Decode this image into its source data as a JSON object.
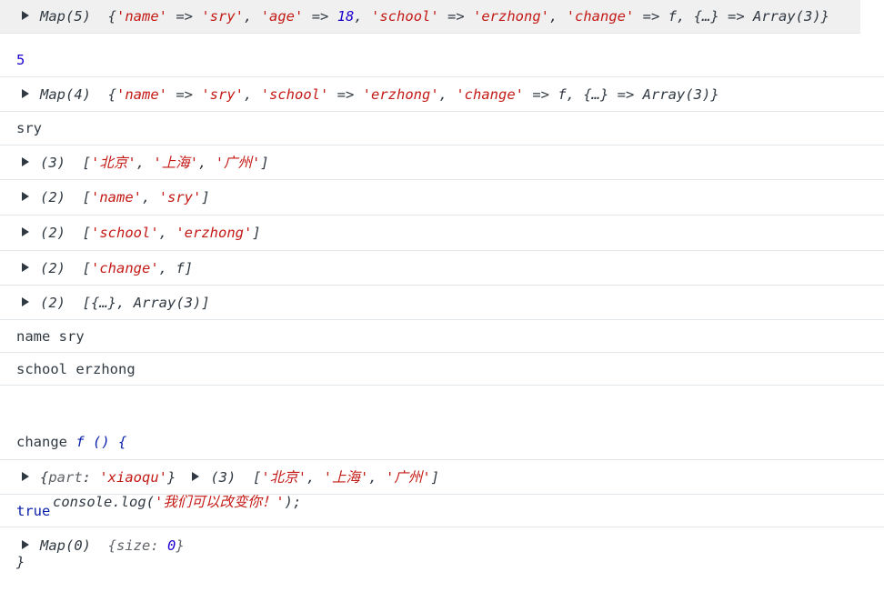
{
  "console": {
    "rows": [
      {
        "id": "map5",
        "label": "Map(5)",
        "parts": [
          "{",
          "'name'",
          " => ",
          "'sry'",
          ", ",
          "'age'",
          " => ",
          "18",
          ", ",
          "'school'",
          " => ",
          "'erzhong'",
          ", ",
          "'change'",
          " => ",
          "f",
          ", ",
          "{…}",
          " => ",
          "Array(3)",
          "}"
        ]
      },
      {
        "id": "n5",
        "value": "5"
      },
      {
        "id": "map4",
        "label": "Map(4)",
        "parts": [
          "{",
          "'name'",
          " => ",
          "'sry'",
          ", ",
          "'school'",
          " => ",
          "'erzhong'",
          ", ",
          "'change'",
          " => ",
          "f",
          ", ",
          "{…}",
          " => ",
          "Array(3)",
          "}"
        ]
      },
      {
        "id": "sry",
        "value": "sry"
      },
      {
        "id": "arr-cities",
        "count": "(3)",
        "parts": [
          "[",
          "'北京'",
          ", ",
          "'上海'",
          ", ",
          "'广州'",
          "]"
        ]
      },
      {
        "id": "arr-name",
        "count": "(2)",
        "parts": [
          "[",
          "'name'",
          ", ",
          "'sry'",
          "]"
        ]
      },
      {
        "id": "arr-school",
        "count": "(2)",
        "parts": [
          "[",
          "'school'",
          ", ",
          "'erzhong'",
          "]"
        ]
      },
      {
        "id": "arr-change",
        "count": "(2)",
        "parts": [
          "[",
          "'change'",
          ", ",
          "f",
          "]"
        ]
      },
      {
        "id": "arr-obj",
        "count": "(2)",
        "parts": [
          "[",
          "{…}",
          ", ",
          "Array(3)",
          "]"
        ]
      },
      {
        "id": "name-sry",
        "value": "name sry"
      },
      {
        "id": "school-erzhong",
        "value": "school erzhong"
      },
      {
        "id": "change-fn",
        "key": "change",
        "sig": "f () {",
        "body_call": "console.log(",
        "body_str": "'我们可以改变你！'",
        "body_end": ");",
        "close": "}"
      },
      {
        "id": "obj-arr",
        "obj_open": "{",
        "obj_key": "part",
        "obj_colon": ": ",
        "obj_val": "'xiaoqu'",
        "obj_close": "}",
        "count": "(3)",
        "parts": [
          "[",
          "'北京'",
          ", ",
          "'上海'",
          ", ",
          "'广州'",
          "]"
        ]
      },
      {
        "id": "bool-true",
        "value": "true"
      },
      {
        "id": "map0",
        "label": "Map(0)",
        "size_text": "{size: ",
        "size_val": "0",
        "size_close": "}"
      }
    ]
  },
  "colors": {
    "string": "#c41a16",
    "number": "#1c00cf",
    "keyword": "#0d22aa",
    "text": "#303942",
    "border": "#e0e6ea",
    "highlight": "#f0f0f0"
  },
  "icons": {
    "expand": "expand-triangle-icon"
  }
}
